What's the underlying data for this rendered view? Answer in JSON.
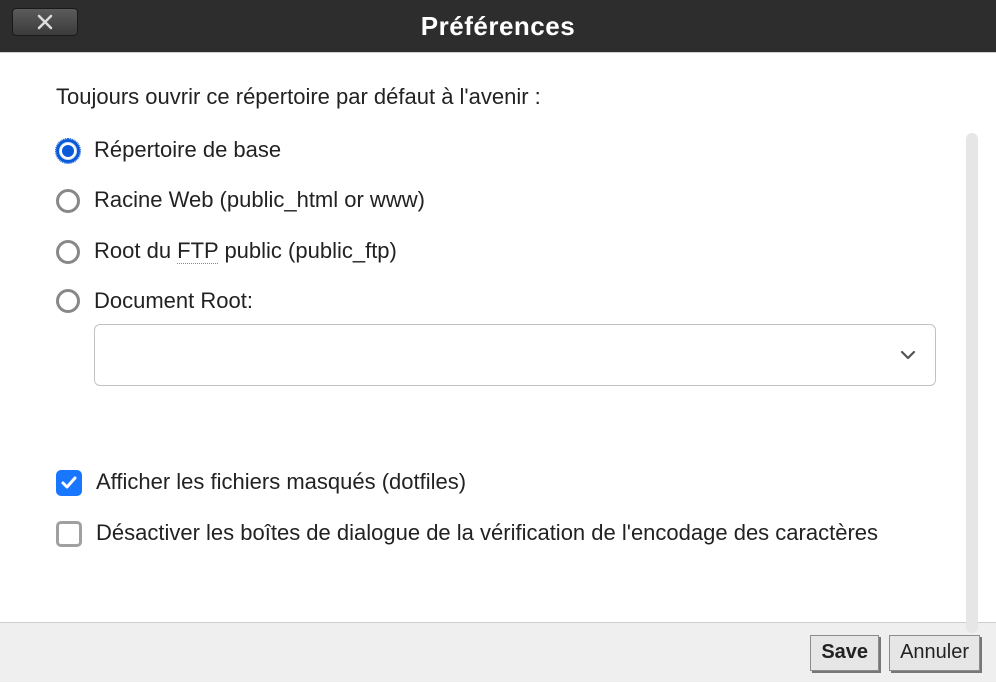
{
  "title": "Préférences",
  "intro": "Toujours ouvrir ce répertoire par défaut à l'avenir :",
  "radios": {
    "base": "Répertoire de base",
    "web_prefix": "Racine Web (public_html or www)",
    "ftp_prefix": "Root du ",
    "ftp_abbr": "FTP",
    "ftp_suffix": " public (public_ftp)",
    "docroot": "Document Root:"
  },
  "select_value": "",
  "checks": {
    "dotfiles": "Afficher les fichiers masqués (dotfiles)",
    "encoding": "Désactiver les boîtes de dialogue de la vérification de l'encodage des caractères"
  },
  "buttons": {
    "save": "Save",
    "cancel": "Annuler"
  }
}
